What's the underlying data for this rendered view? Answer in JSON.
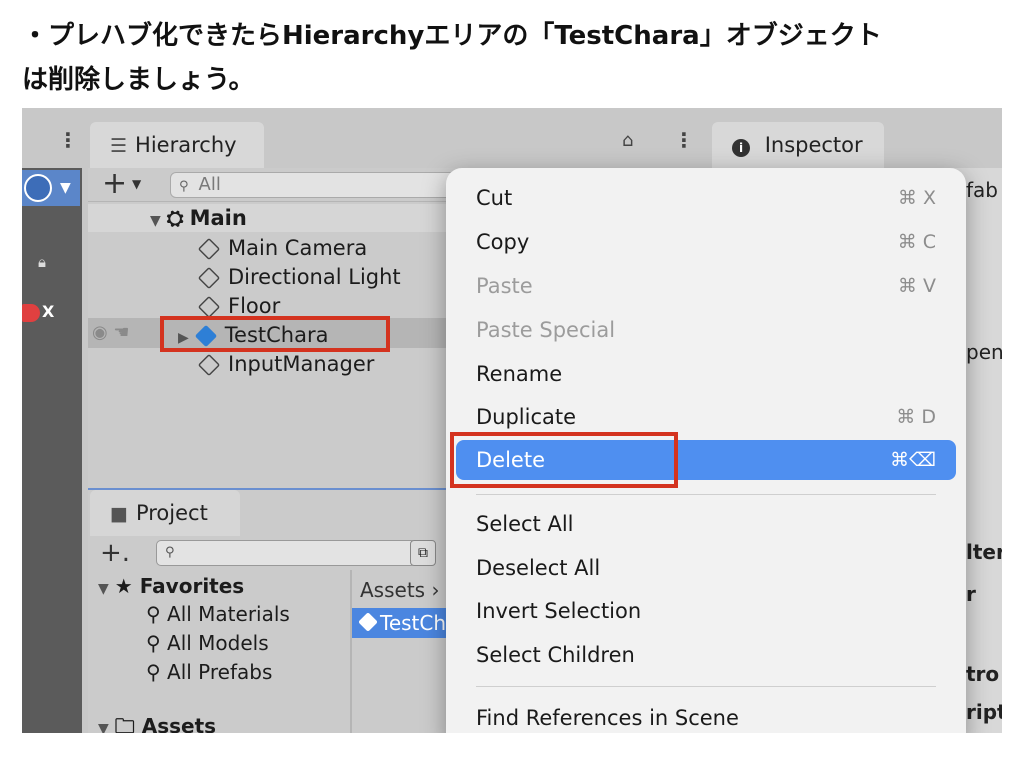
{
  "instruction": {
    "line1": "・プレハブ化できたらHierarchyエリアの「TestChara」オブジェクト",
    "line2": "は削除しましょう。"
  },
  "hierarchy": {
    "tab_label": "Hierarchy",
    "tab_icon": "list-icon",
    "search_placeholder": "All",
    "items": [
      {
        "label": "Main"
      },
      {
        "label": "Main Camera"
      },
      {
        "label": "Directional Light"
      },
      {
        "label": "Floor"
      },
      {
        "label": "TestChara"
      },
      {
        "label": "InputManager"
      }
    ]
  },
  "inspector": {
    "tab_label": "Inspector",
    "tab_icon": "info-icon",
    "peeking": [
      "fab",
      "pen",
      "lter",
      "r",
      "tro",
      "ript"
    ]
  },
  "project": {
    "tab_label": "Project",
    "favorites_label": "Favorites",
    "favorites": [
      "All Materials",
      "All Models",
      "All Prefabs"
    ],
    "assets_root": "Assets",
    "assets_breadcrumb": "Assets",
    "selected_asset": "TestChara"
  },
  "context_menu": {
    "items": [
      {
        "label": "Cut",
        "shortcut": "⌘ X",
        "enabled": true
      },
      {
        "label": "Copy",
        "shortcut": "⌘ C",
        "enabled": true
      },
      {
        "label": "Paste",
        "shortcut": "⌘ V",
        "enabled": false
      },
      {
        "label": "Paste Special",
        "shortcut": "",
        "enabled": false
      },
      {
        "label": "Rename",
        "shortcut": "",
        "enabled": true
      },
      {
        "label": "Duplicate",
        "shortcut": "⌘ D",
        "enabled": true
      },
      {
        "label": "Delete",
        "shortcut": "⌘⌫",
        "enabled": true,
        "active": true
      },
      {
        "label": "Select All",
        "shortcut": "",
        "enabled": true
      },
      {
        "label": "Deselect All",
        "shortcut": "",
        "enabled": true
      },
      {
        "label": "Invert Selection",
        "shortcut": "",
        "enabled": true
      },
      {
        "label": "Select Children",
        "shortcut": "",
        "enabled": true
      },
      {
        "label": "Find References in Scene",
        "shortcut": "",
        "enabled": true
      }
    ]
  },
  "scene": {
    "axis_label": "X"
  },
  "colors": {
    "highlight_red": "#d4331f",
    "menu_active_blue": "#4f8ff0",
    "selection_blue": "#4b86e0"
  }
}
